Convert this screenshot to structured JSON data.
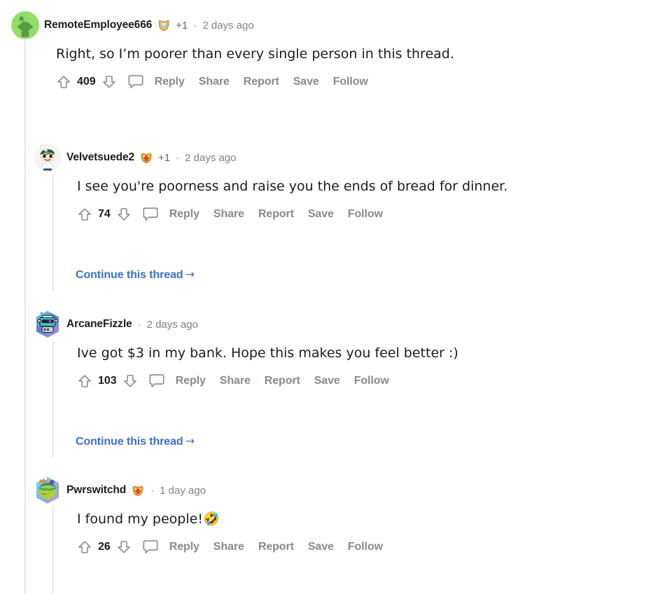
{
  "theme": {
    "background": "#ffffff",
    "text_primary": "#1c1c1c",
    "text_muted": "#7c8187",
    "action_gray": "#878a8c",
    "link_blue": "#3b6ec8",
    "threadline": "#e5e7eb"
  },
  "comments": [
    {
      "id": "comment-1",
      "depth": 0,
      "username": "RemoteEmployee666",
      "avatar": "snoo-green-avatar",
      "badge": "gem-shield-award-icon",
      "award_count": "+1",
      "separator": "·",
      "timestamp": "2 days ago",
      "body": "Right, so I’m poorer than every single person in this thread.",
      "emoji": "",
      "score": "409",
      "actions": [
        "Reply",
        "Share",
        "Report",
        "Save",
        "Follow"
      ],
      "continue_thread": ""
    },
    {
      "id": "comment-2",
      "depth": 1,
      "username": "Velvetsuede2",
      "avatar": "chef-hat-snoo-avatar",
      "badge": "orange-uparrow-shield-award-icon",
      "award_count": "+1",
      "separator": "·",
      "timestamp": "2 days ago",
      "body": "I see you're poorness and raise you the ends of bread for dinner.",
      "emoji": "",
      "score": "74",
      "actions": [
        "Reply",
        "Share",
        "Report",
        "Save",
        "Follow"
      ],
      "continue_thread": "Continue this thread"
    },
    {
      "id": "comment-3",
      "depth": 1,
      "username": "ArcaneFizzle",
      "avatar": "teal-robot-avatar",
      "badge": "",
      "award_count": "",
      "separator": "·",
      "timestamp": "2 days ago",
      "body": "Ive got $3 in my bank. Hope this makes you feel better :)",
      "emoji": "",
      "score": "103",
      "actions": [
        "Reply",
        "Share",
        "Report",
        "Save",
        "Follow"
      ],
      "continue_thread": "Continue this thread"
    },
    {
      "id": "comment-4",
      "depth": 1,
      "username": "Pwrswitchd",
      "avatar": "crowned-green-creature-avatar",
      "badge": "orange-uparrow-shield-award-icon",
      "award_count": "",
      "separator": "·",
      "timestamp": "1 day ago",
      "body": "I found my people!",
      "emoji": "🤣",
      "score": "26",
      "actions": [
        "Reply",
        "Share",
        "Report",
        "Save",
        "Follow"
      ],
      "continue_thread": ""
    }
  ],
  "continue_arrow": "→"
}
